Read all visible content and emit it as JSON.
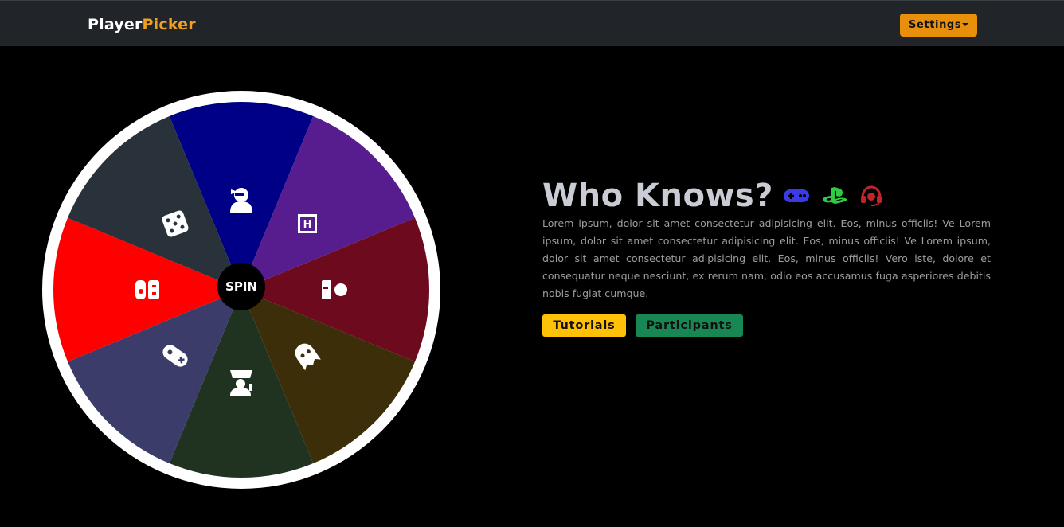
{
  "navbar": {
    "brand_part1": "Player",
    "brand_part2": "Picker",
    "settings_label": "Settings"
  },
  "wheel": {
    "spin_label": "SPIN",
    "segments": [
      {
        "color": "#000087",
        "icon": "user-ninja-icon"
      },
      {
        "color": "#571d8f",
        "icon": "hacker-news-icon"
      },
      {
        "color": "#6e0a1e",
        "icon": "controller-icon"
      },
      {
        "color": "#3d2e0a",
        "icon": "ghost-icon"
      },
      {
        "color": "#1f3320",
        "icon": "detective-icon"
      },
      {
        "color": "#3c3c6b",
        "icon": "gamepad-icon"
      },
      {
        "color": "#ff0000",
        "icon": "nintendo-switch-icon"
      },
      {
        "color": "#29313a",
        "icon": "dice-icon"
      }
    ]
  },
  "main": {
    "title": "Who Knows?",
    "header_icons": [
      {
        "name": "gamepad-icon",
        "color": "#3a3ae6"
      },
      {
        "name": "playstation-icon",
        "color": "#2ecc40"
      },
      {
        "name": "headset-icon",
        "color": "#c0242c"
      }
    ],
    "description": "Lorem ipsum, dolor sit amet consectetur adipisicing elit. Eos, minus officiis! Ve Lorem ipsum, dolor sit amet consectetur adipisicing elit. Eos, minus officiis! Ve Lorem ipsum, dolor sit amet consectetur adipisicing elit. Eos, minus officiis! Vero iste, dolore et consequatur neque nesciunt, ex rerum nam, odio eos accusamus fuga asperiores debitis nobis fugiat cumque.",
    "tutorials_label": "Tutorials",
    "participants_label": "Participants"
  }
}
